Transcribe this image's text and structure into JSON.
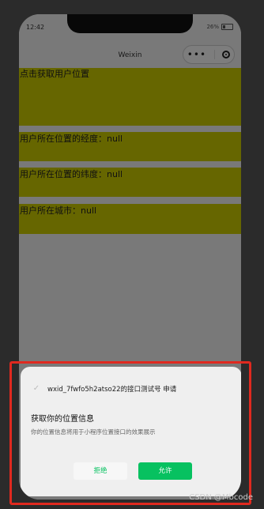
{
  "status": {
    "time": "12:42",
    "battery": "26%"
  },
  "navbar": {
    "title": "Weixin",
    "more_icon": "more-dots-icon",
    "close_icon": "target-icon"
  },
  "content": {
    "get_location": "点击获取用户位置",
    "longitude": "用户所在位置的经度：null",
    "latitude": "用户所在位置的纬度：null",
    "city": "用户所在城市：null"
  },
  "dialog": {
    "app_name": "wxid_7fwfo5h2atso22的接口测试号 申请",
    "permission_title": "获取你的位置信息",
    "permission_desc": "你的位置信息将用于小程序位置接口的效果展示",
    "deny_label": "拒绝",
    "allow_label": "允许"
  },
  "watermark": "CSDN @Mbcode",
  "colors": {
    "highlight": "#cccc00",
    "accent": "#07c160",
    "frame": "#e0291f"
  }
}
